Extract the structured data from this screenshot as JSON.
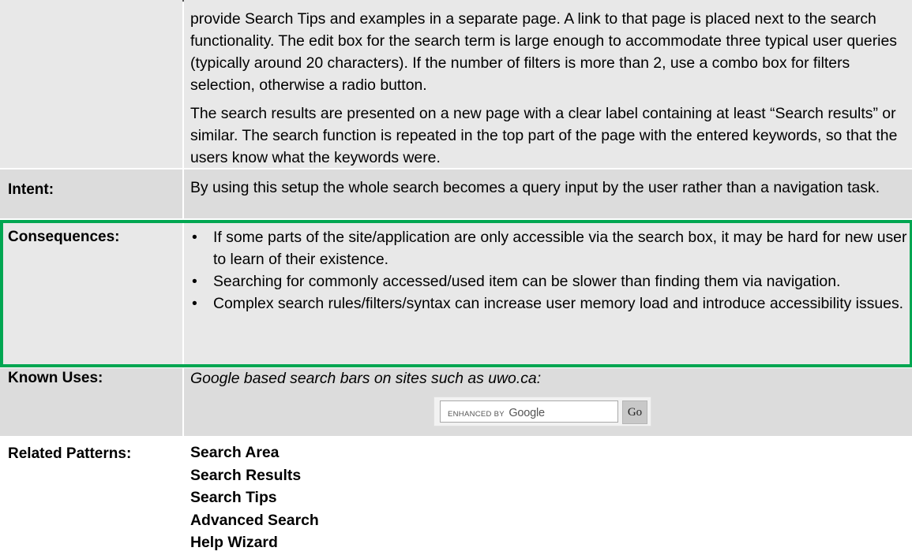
{
  "solution": {
    "paragraphs": [
      "provide Search Tips and examples in a separate page. A link to that page is placed next to the search functionality. The edit box for the search term is large enough to accommodate three typical user queries (typically around 20 characters). If the number of filters is more than 2, use a combo box for filters selection, otherwise a radio button.",
      "The search results are presented on a new page with a clear label containing at least “Search results” or similar. The search function is repeated in the top part of the page with the entered keywords, so that the users know what the keywords were."
    ]
  },
  "intent": {
    "label": "Intent:",
    "text": "By using this setup the whole search becomes a query input by the user rather than a navigation task."
  },
  "consequences": {
    "label": "Consequences:",
    "highlight_color": "#00a651",
    "items": [
      "If some parts of the site/application are only accessible via the search box, it may be hard for new user to learn of their existence.",
      "Searching for commonly accessed/used item can be slower than finding them via navigation.",
      "Complex search rules/filters/syntax can increase user memory load and introduce accessibility issues."
    ]
  },
  "known_uses": {
    "label": "Known Uses:",
    "text": "Google based search bars on sites such as uwo.ca:",
    "search_widget": {
      "enhanced_by": "ENHANCED BY",
      "brand": "Google",
      "go_label": "Go"
    }
  },
  "related_patterns": {
    "label": "Related Patterns:",
    "items": [
      "Search Area",
      "Search Results",
      "Search Tips",
      "Advanced Search",
      "Help Wizard"
    ]
  }
}
